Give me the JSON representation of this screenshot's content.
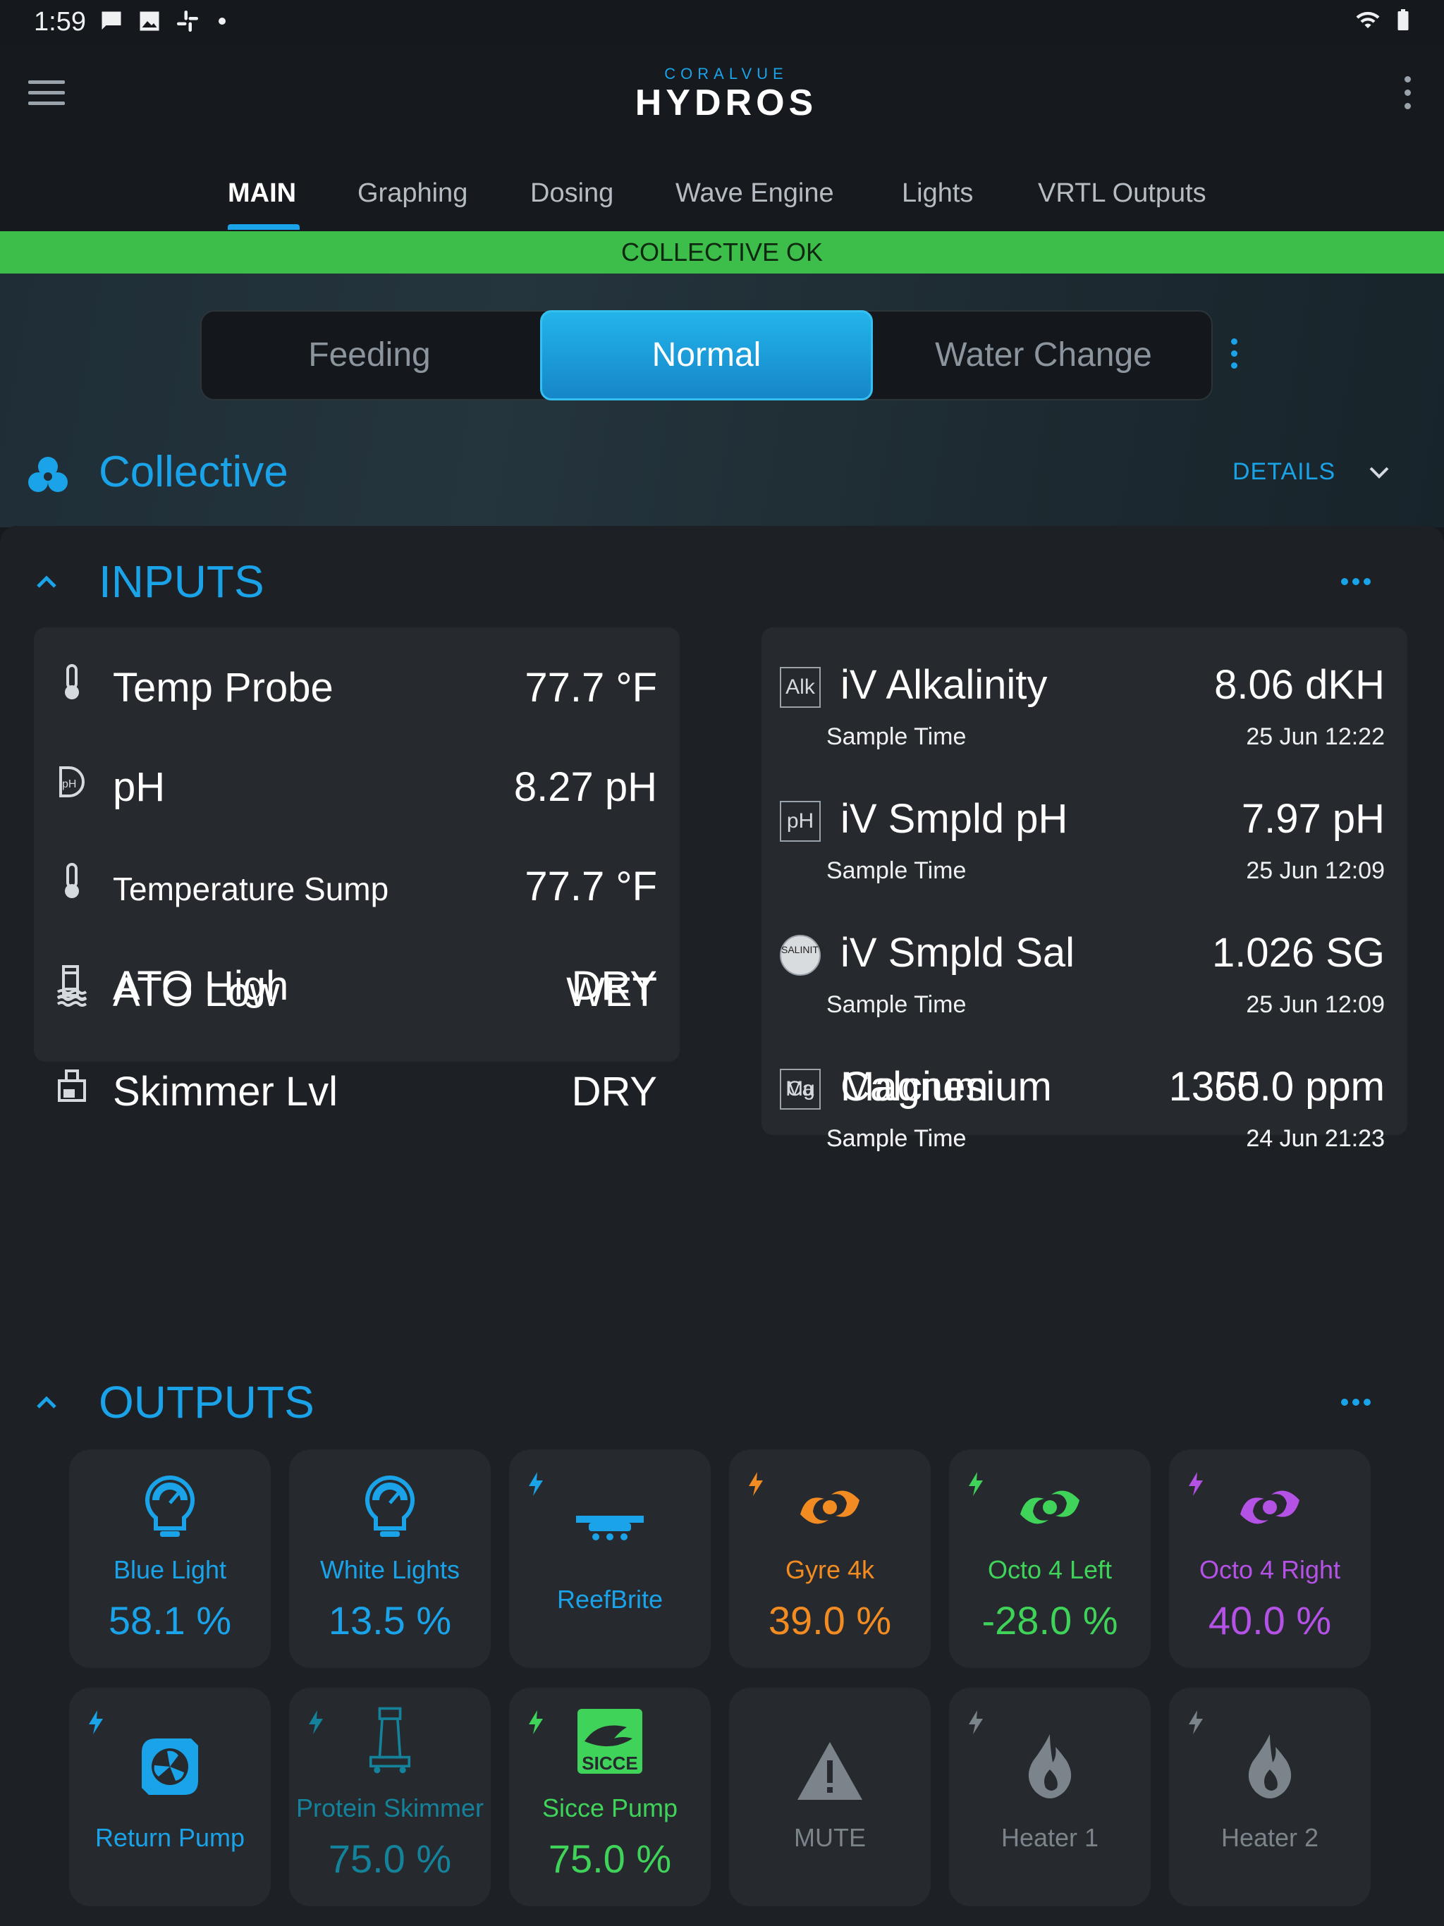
{
  "status_bar": {
    "time": "1:59"
  },
  "header": {
    "brand_top": "CORALVUE",
    "brand_main": "HYDROS",
    "tabs": [
      "MAIN",
      "Graphing",
      "Dosing",
      "Wave Engine",
      "Lights",
      "VRTL Outputs"
    ],
    "active_tab": "MAIN"
  },
  "banner": {
    "text": "COLLECTIVE OK",
    "color": "#3dbd4a"
  },
  "modes": {
    "items": [
      "Feeding",
      "Normal",
      "Water Change"
    ],
    "active": "Normal"
  },
  "collective": {
    "title": "Collective",
    "details_label": "DETAILS"
  },
  "inputs": {
    "title": "INPUTS",
    "left": [
      {
        "name": "Temp Probe",
        "value": "77.7 °F",
        "icon": "thermometer-icon"
      },
      {
        "name": "pH",
        "value": "8.27 pH",
        "icon": "ph-probe-icon"
      },
      {
        "name": "Temperature Sump",
        "value": "77.7 °F",
        "icon": "thermometer-icon"
      },
      {
        "name": "ATO High",
        "value": "DRY",
        "icon": "water-level-icon"
      },
      {
        "name": "ATO Low",
        "value": "WET",
        "icon": "water-level-icon"
      },
      {
        "name": "Skimmer Lvl",
        "value": "DRY",
        "icon": "skimmer-level-icon"
      }
    ],
    "right": [
      {
        "badge": "Alk",
        "name": "iV Alkalinity",
        "value": "8.06 dKH",
        "sub": "Sample Time",
        "time": "25 Jun 12:22"
      },
      {
        "badge": "pH",
        "name": "iV Smpld pH",
        "value": "7.97 pH",
        "sub": "Sample Time",
        "time": "25 Jun 12:09"
      },
      {
        "badge": "SALINITY",
        "name": "iV Smpld Sal",
        "value": "1.026 SG",
        "sub": "Sample Time",
        "time": "25 Jun 12:09"
      },
      {
        "badge": "Ca",
        "name": "Calcium",
        "value": "365.0 ppm",
        "sub": "Sample Time",
        "time": "24 Jun 21:23"
      },
      {
        "badge": "Mg",
        "name": "Magnesium",
        "value": "1350.0 ppm",
        "sub": "Sample Time",
        "time": "24 Jun 21:23"
      }
    ]
  },
  "outputs": {
    "title": "OUTPUTS",
    "tiles": [
      {
        "name": "Blue Light",
        "value": "58.1 %",
        "icon": "light-bulb-gauge-icon",
        "color": "#1aa3e8",
        "bolt": false
      },
      {
        "name": "White Lights",
        "value": "13.5 %",
        "icon": "light-bulb-gauge-icon",
        "color": "#1aa3e8",
        "bolt": false
      },
      {
        "name": "ReefBrite",
        "value": "",
        "icon": "led-fixture-icon",
        "color": "#1aa3e8",
        "bolt": true
      },
      {
        "name": "Gyre 4k",
        "value": "39.0 %",
        "icon": "wave-pump-icon",
        "color": "#f28c22",
        "bolt": true
      },
      {
        "name": "Octo 4 Left",
        "value": "-28.0 %",
        "icon": "wave-pump-icon",
        "color": "#3fd35a",
        "bolt": true
      },
      {
        "name": "Octo 4 Right",
        "value": "40.0 %",
        "icon": "wave-pump-icon",
        "color": "#b552e6",
        "bolt": true
      },
      {
        "name": "Return Pump",
        "value": "",
        "icon": "return-pump-icon",
        "color": "#1aa3e8",
        "bolt": true
      },
      {
        "name": "Protein Skimmer",
        "value": "75.0 %",
        "icon": "protein-skimmer-icon",
        "color": "#14829a",
        "bolt": true
      },
      {
        "name": "Sicce Pump",
        "value": "75.0 %",
        "icon": "sicce-logo-icon",
        "color": "#3fd35a",
        "bolt": true
      },
      {
        "name": "MUTE",
        "value": "",
        "icon": "warning-icon",
        "color": "#7b838b",
        "bolt": false
      },
      {
        "name": "Heater 1",
        "value": "",
        "icon": "heater-flame-icon",
        "color": "#7b838b",
        "bolt": true
      },
      {
        "name": "Heater 2",
        "value": "",
        "icon": "heater-flame-icon",
        "color": "#7b838b",
        "bolt": true
      }
    ]
  }
}
